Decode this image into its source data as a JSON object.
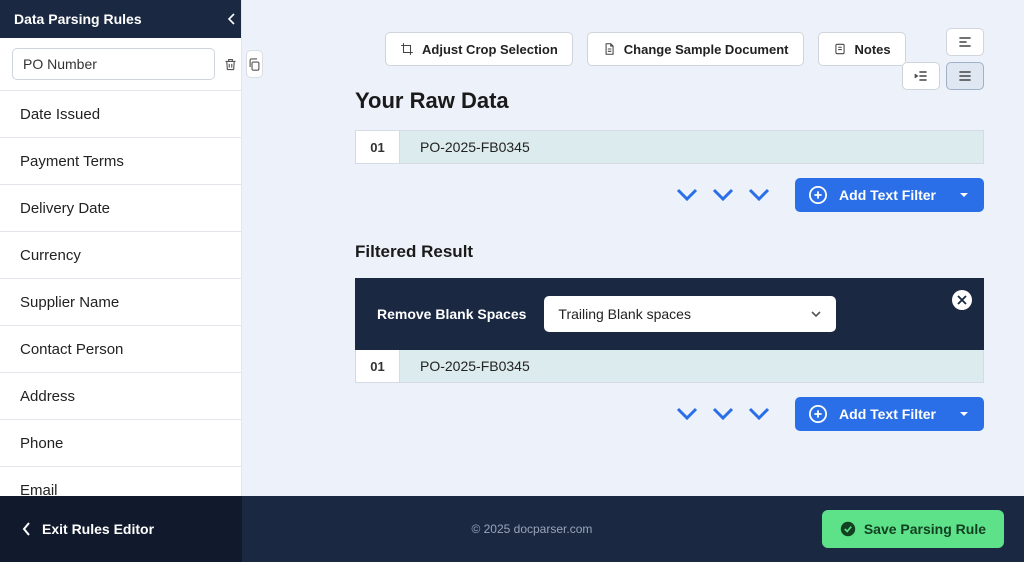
{
  "sidebar": {
    "title": "Data Parsing Rules",
    "active_rule_value": "PO Number",
    "items": [
      "Date Issued",
      "Payment Terms",
      "Delivery Date",
      "Currency",
      "Supplier Name",
      "Contact Person",
      "Address",
      "Phone",
      "Email"
    ]
  },
  "toolbar": {
    "adjust_crop": "Adjust Crop Selection",
    "change_sample": "Change Sample Document",
    "notes": "Notes"
  },
  "raw": {
    "heading": "Your Raw Data",
    "rows": [
      {
        "num": "01",
        "value": "PO-2025-FB0345"
      }
    ],
    "add_filter": "Add Text Filter"
  },
  "filtered": {
    "heading": "Filtered Result",
    "filter_label": "Remove Blank Spaces",
    "filter_option": "Trailing Blank spaces",
    "rows": [
      {
        "num": "01",
        "value": "PO-2025-FB0345"
      }
    ],
    "add_filter": "Add Text Filter"
  },
  "footer": {
    "exit": "Exit Rules Editor",
    "copyright": "© 2025 docparser.com",
    "save": "Save Parsing Rule"
  }
}
